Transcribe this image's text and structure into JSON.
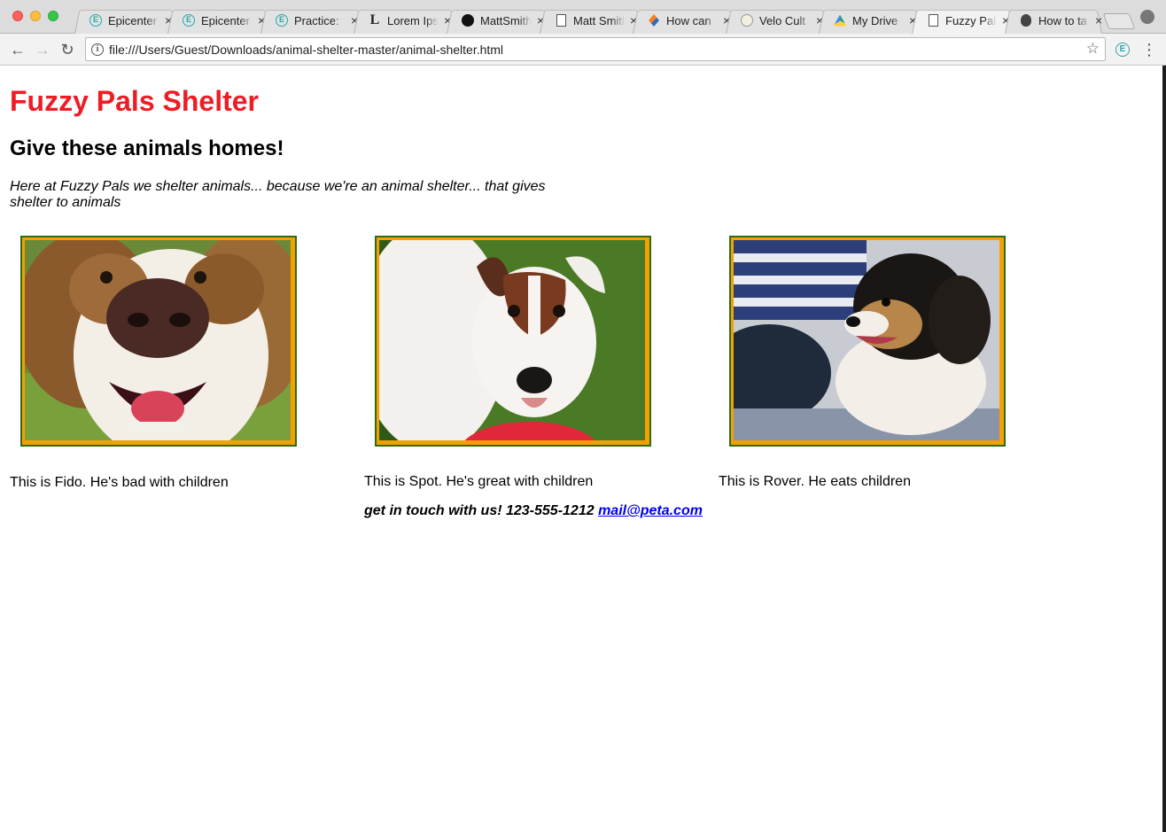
{
  "browser": {
    "tabs": [
      {
        "title": "Epicenter",
        "icon": "epicenter-icon"
      },
      {
        "title": "Epicenter",
        "icon": "epicenter-icon"
      },
      {
        "title": "Practice:",
        "icon": "epicenter-icon"
      },
      {
        "title": "Lorem Ipsum",
        "icon": "lorem-ipsum-icon"
      },
      {
        "title": "MattSmith",
        "icon": "github-icon"
      },
      {
        "title": "Matt Smith",
        "icon": "document-icon"
      },
      {
        "title": "How can",
        "icon": "stackoverflow-icon"
      },
      {
        "title": "Velo Cult",
        "icon": "velo-cult-icon"
      },
      {
        "title": "My Drive",
        "icon": "google-drive-icon"
      },
      {
        "title": "Fuzzy Pals",
        "icon": "document-icon",
        "active": true
      },
      {
        "title": "How to ta",
        "icon": "apple-icon"
      }
    ],
    "tab_close_glyph": "×",
    "url": "file:///Users/Guest/Downloads/animal-shelter-master/animal-shelter.html",
    "back_glyph": "←",
    "forward_glyph": "→",
    "reload_glyph": "↻",
    "info_glyph": "i",
    "star_glyph": "☆",
    "extension_glyph": "E",
    "menu_glyph": "⋮"
  },
  "page": {
    "title": "Fuzzy Pals Shelter",
    "subtitle": "Give these animals homes!",
    "intro": "Here at Fuzzy Pals we shelter animals... because we're an animal shelter... that gives shelter to animals",
    "pets": [
      {
        "name": "Fido",
        "caption": "This is Fido. He's bad with children"
      },
      {
        "name": "Spot",
        "caption": "This is Spot. He's great with children"
      },
      {
        "name": "Rover",
        "caption": "This is Rover. He eats children"
      }
    ],
    "contact": {
      "text": "get in touch with us! 123-555-1212",
      "email": "mail@peta.com"
    }
  },
  "colors": {
    "title_red": "#ee1c25",
    "frame_orange": "#f4a000",
    "frame_green": "#2e6b16",
    "link_blue": "#0000ee"
  }
}
